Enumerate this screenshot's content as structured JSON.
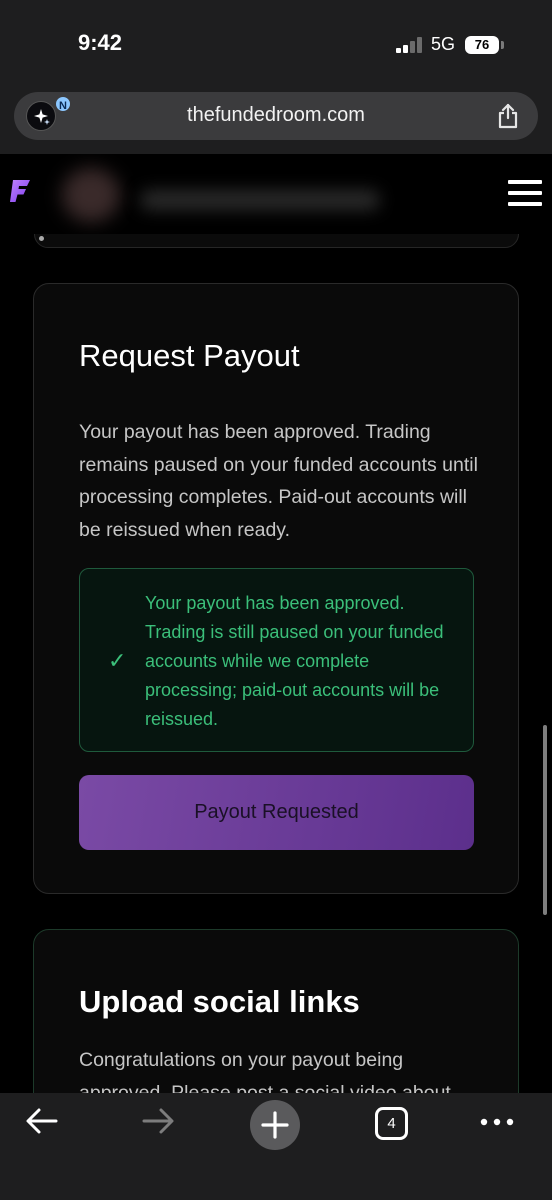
{
  "status_bar": {
    "time": "9:42",
    "network": "5G",
    "battery": "76"
  },
  "browser": {
    "url": "thefundedroom.com",
    "ai_badge": "N",
    "tab_count": "4"
  },
  "icons": {
    "ai_assistant": "sparkle-icon",
    "share": "share-icon",
    "logo": "F-logo",
    "menu": "hamburger-icon",
    "check": "check-icon",
    "back": "back-arrow-icon",
    "forward": "forward-arrow-icon",
    "new_tab": "plus-icon",
    "tabs": "tabs-icon",
    "more": "more-icon"
  },
  "colors": {
    "accent_purple": "#7a4aa5",
    "success_green": "#3bbf7a",
    "logo_purple": "#a855f7"
  },
  "payout_card": {
    "title": "Request Payout",
    "description": "Your payout has been approved. Trading remains paused on your funded accounts until processing completes. Paid-out accounts will be reissued when ready.",
    "notice_check": "✓",
    "notice": "Your payout has been approved. Trading is still paused on your funded accounts while we complete processing; paid-out accounts will be reissued.",
    "button_label": "Payout Requested"
  },
  "social_card": {
    "title": "Upload social links",
    "description": "Congratulations on your payout being approved. Please post a social video about"
  }
}
